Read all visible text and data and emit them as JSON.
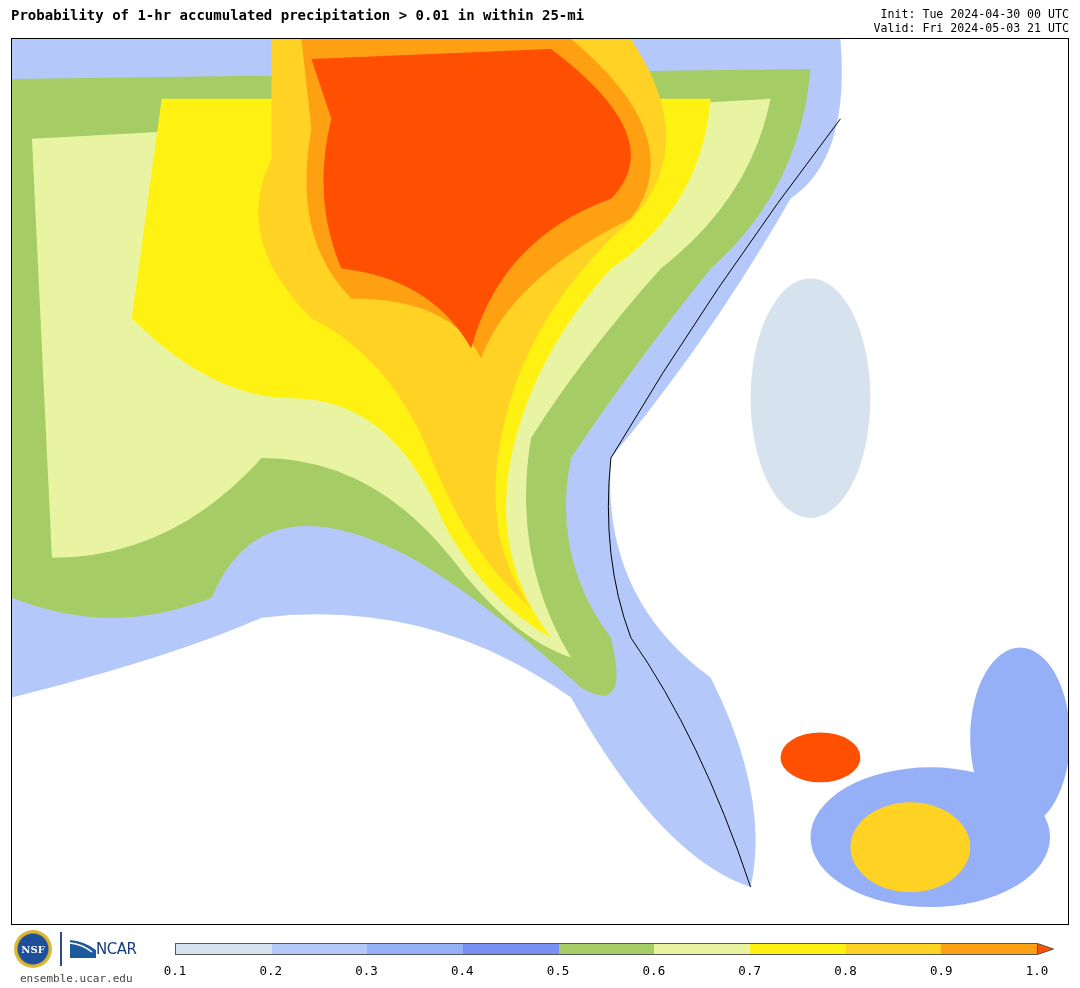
{
  "header": {
    "title": "Probability of 1-hr accumulated precipitation > 0.01 in within 25-mi",
    "init": "Init: Tue 2024-04-30 00 UTC",
    "valid": "Valid: Fri 2024-05-03 21 UTC"
  },
  "footer": {
    "nsf_logo": "NSF",
    "ncar_logo": "NCAR",
    "site": "ensemble.ucar.edu"
  },
  "colorbar": {
    "bins": [
      {
        "color": "#d6e2ee"
      },
      {
        "color": "#b4c8fa"
      },
      {
        "color": "#96b0f8"
      },
      {
        "color": "#7a8ff4"
      },
      {
        "color": "#a6cc66"
      },
      {
        "color": "#e8f4a2"
      },
      {
        "color": "#fff212"
      },
      {
        "color": "#ffd224"
      },
      {
        "color": "#ffa012"
      }
    ],
    "extension": {
      "color": "#ff4f00"
    },
    "ticks": [
      "0.1",
      "0.2",
      "0.3",
      "0.4",
      "0.5",
      "0.6",
      "0.7",
      "0.8",
      "0.9",
      "1.0"
    ]
  }
}
